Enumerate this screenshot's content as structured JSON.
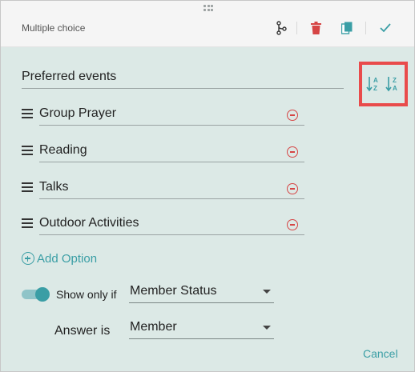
{
  "header": {
    "title": "Multiple choice",
    "icons": [
      "branch-icon",
      "trash-icon",
      "copy-icon",
      "check-icon"
    ],
    "colors": {
      "branch": "#333333",
      "trash": "#d64545",
      "copy": "#3a9ea5",
      "check": "#3a9ea5"
    }
  },
  "question": {
    "value": "Preferred events"
  },
  "sort": {
    "ascending_icon": "sort-alpha-asc-icon",
    "descending_icon": "sort-alpha-desc-icon",
    "highlight_color": "#e94b4b"
  },
  "options": [
    {
      "label": "Group Prayer"
    },
    {
      "label": "Reading"
    },
    {
      "label": "Talks"
    },
    {
      "label": "Outdoor Activities"
    }
  ],
  "add_option": {
    "label": "Add Option"
  },
  "condition": {
    "toggle_on": true,
    "show_only_if_label": "Show only if",
    "field_value": "Member Status",
    "answer_is_label": "Answer is",
    "answer_value": "Member"
  },
  "footer": {
    "cancel_label": "Cancel"
  },
  "theme": {
    "accent": "#3a9ea5",
    "panel_bg": "#dce9e6",
    "header_bg": "#f5f5f5"
  }
}
